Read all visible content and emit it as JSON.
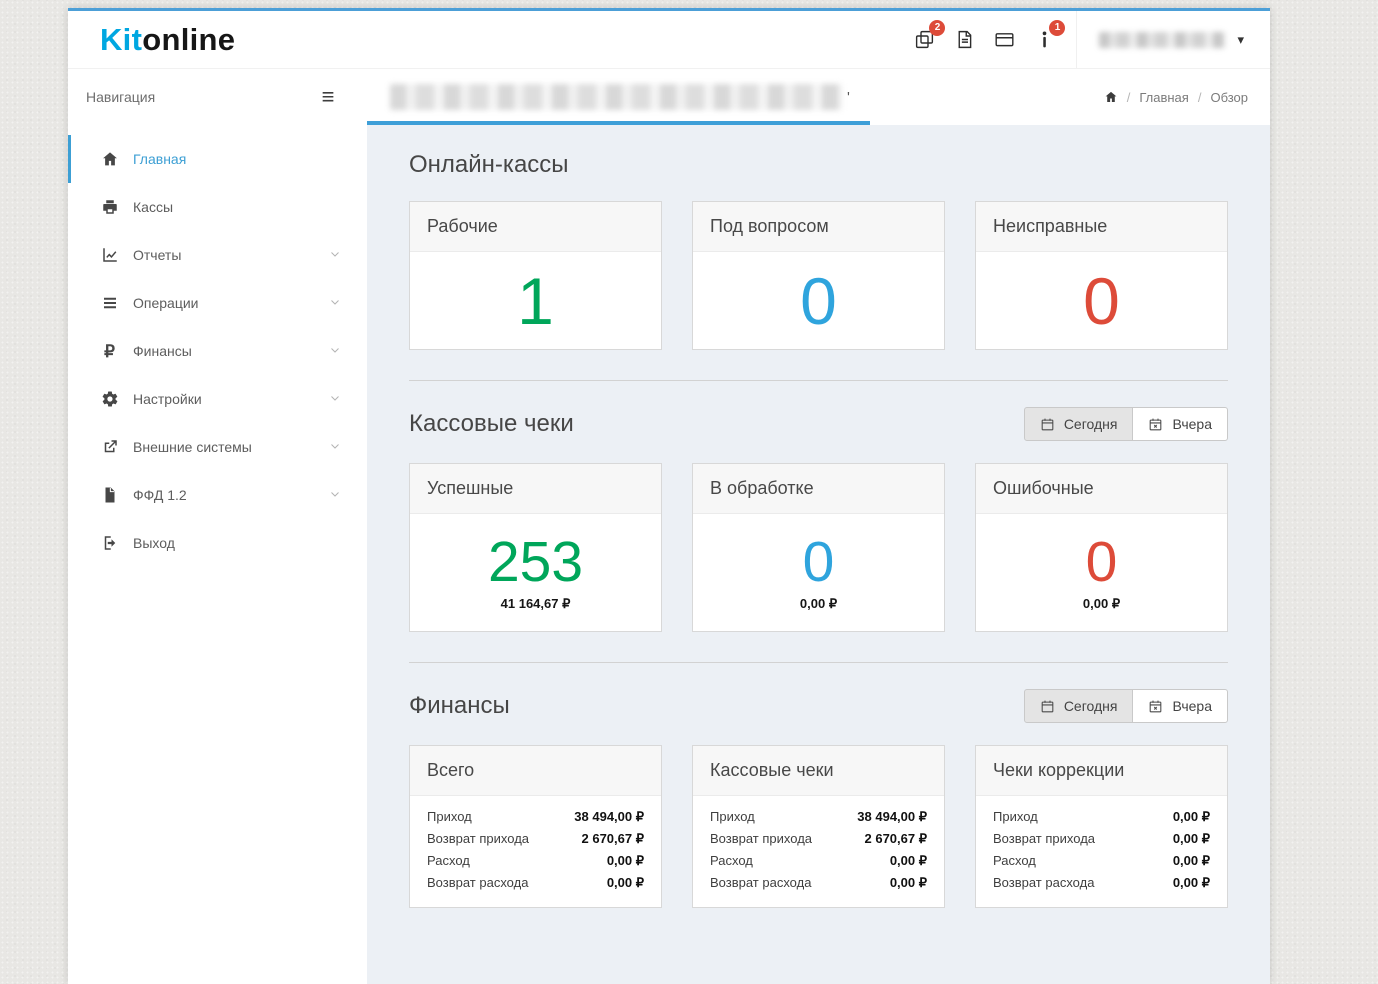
{
  "colors": {
    "accent_blue": "#3c9fd4",
    "top_border_blue": "#4c9fd7",
    "logo_blue": "#00a7e1",
    "success_green": "#00a65a",
    "info_blue": "#2fa4dd",
    "danger_red": "#dd4b39",
    "badge_red": "#dd4b39",
    "content_bg": "#ecf0f5"
  },
  "brand": {
    "name_primary": "Kit",
    "name_secondary": "online"
  },
  "header": {
    "devices_badge": "2",
    "info_badge": "1"
  },
  "glyphs": {
    "hamburger": "≡",
    "caret": "▾",
    "ruble": "₽"
  },
  "titlebar": {
    "suffix": "'"
  },
  "sidebar": {
    "title": "Навигация",
    "items": [
      {
        "label": "Главная"
      },
      {
        "label": "Кассы"
      },
      {
        "label": "Отчеты"
      },
      {
        "label": "Операции"
      },
      {
        "label": "Финансы"
      },
      {
        "label": "Настройки"
      },
      {
        "label": "Внешние системы"
      },
      {
        "label": "ФФД 1.2"
      },
      {
        "label": "Выход"
      }
    ]
  },
  "breadcrumb": {
    "items": [
      "Главная",
      "Обзор"
    ]
  },
  "sections": {
    "cashdesks": {
      "title": "Онлайн-кассы",
      "cards": [
        {
          "title": "Рабочие",
          "value": "1",
          "color": "#00a65a"
        },
        {
          "title": "Под вопросом",
          "value": "0",
          "color": "#2fa4dd"
        },
        {
          "title": "Неисправные",
          "value": "0",
          "color": "#dd4b39"
        }
      ]
    },
    "receipts": {
      "title": "Кассовые чеки",
      "filter": {
        "today": "Сегодня",
        "yesterday": "Вчера"
      },
      "cards": [
        {
          "title": "Успешные",
          "value": "253",
          "amount": "41 164,67 ₽",
          "color": "#00a65a"
        },
        {
          "title": "В обработке",
          "value": "0",
          "amount": "0,00 ₽",
          "color": "#2fa4dd"
        },
        {
          "title": "Ошибочные",
          "value": "0",
          "amount": "0,00 ₽",
          "color": "#dd4b39"
        }
      ]
    },
    "finance": {
      "title": "Финансы",
      "filter": {
        "today": "Сегодня",
        "yesterday": "Вчера"
      },
      "cards": [
        {
          "title": "Всего",
          "rows": [
            {
              "label": "Приход",
              "value": "38 494,00 ₽"
            },
            {
              "label": "Возврат прихода",
              "value": "2 670,67 ₽"
            },
            {
              "label": "Расход",
              "value": "0,00 ₽"
            },
            {
              "label": "Возврат расхода",
              "value": "0,00 ₽"
            }
          ]
        },
        {
          "title": "Кассовые чеки",
          "rows": [
            {
              "label": "Приход",
              "value": "38 494,00 ₽"
            },
            {
              "label": "Возврат прихода",
              "value": "2 670,67 ₽"
            },
            {
              "label": "Расход",
              "value": "0,00 ₽"
            },
            {
              "label": "Возврат расхода",
              "value": "0,00 ₽"
            }
          ]
        },
        {
          "title": "Чеки коррекции",
          "rows": [
            {
              "label": "Приход",
              "value": "0,00 ₽"
            },
            {
              "label": "Возврат прихода",
              "value": "0,00 ₽"
            },
            {
              "label": "Расход",
              "value": "0,00 ₽"
            },
            {
              "label": "Возврат расхода",
              "value": "0,00 ₽"
            }
          ]
        }
      ]
    }
  }
}
